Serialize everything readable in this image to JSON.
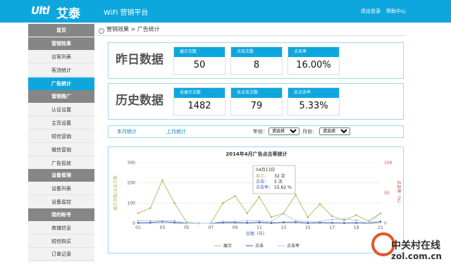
{
  "header": {
    "logo_mark": "Ultl",
    "logo_text": "艾泰",
    "app_title": "WiFi 营销平台",
    "logout": "退出登录",
    "help": "帮助中心"
  },
  "sidebar": {
    "items": [
      {
        "label": "首页",
        "kind": "head"
      },
      {
        "label": "营销效果",
        "kind": "head"
      },
      {
        "label": "访客列表",
        "kind": "plain"
      },
      {
        "label": "客流统计",
        "kind": "plain"
      },
      {
        "label": "广告统计",
        "kind": "active"
      },
      {
        "label": "营销推广",
        "kind": "head"
      },
      {
        "label": "认证设置",
        "kind": "plain"
      },
      {
        "label": "主页设置",
        "kind": "plain"
      },
      {
        "label": "短信营销",
        "kind": "plain"
      },
      {
        "label": "微信营销",
        "kind": "plain"
      },
      {
        "label": "广告投放",
        "kind": "plain"
      },
      {
        "label": "设备管理",
        "kind": "head"
      },
      {
        "label": "设备列表",
        "kind": "plain"
      },
      {
        "label": "设备监控",
        "kind": "plain"
      },
      {
        "label": "我的帐号",
        "kind": "head"
      },
      {
        "label": "商铺信息",
        "kind": "plain"
      },
      {
        "label": "短信购买",
        "kind": "plain"
      },
      {
        "label": "订单记录",
        "kind": "plain"
      }
    ]
  },
  "breadcrumb": "营销效果 > 广告统计",
  "yesterday": {
    "label": "昨日数据",
    "stats": [
      {
        "title": "展示次数",
        "value": "50"
      },
      {
        "title": "点击次数",
        "value": "8"
      },
      {
        "title": "点击率",
        "value": "16.00%"
      }
    ]
  },
  "history": {
    "label": "历史数据",
    "stats": [
      {
        "title": "总展示次数",
        "value": "1482"
      },
      {
        "title": "总点击次数",
        "value": "79"
      },
      {
        "title": "总点击率",
        "value": "5.33%"
      }
    ]
  },
  "filter": {
    "this_month": "本月统计",
    "last_month": "上月统计",
    "year_label": "年份：",
    "year_value": "请选择",
    "month_label": "月份：",
    "month_value": "请选择"
  },
  "colors": {
    "accent": "#0da7de",
    "show_series": "#b5b35c",
    "click_series": "#3a5fb0",
    "rate_series": "#a8c6e8",
    "right_axis": "#c0504d"
  },
  "chart_data": {
    "type": "line",
    "title": "2014年4月广告点击率统计",
    "xlabel": "日期（号）",
    "ylabel_left": "展示次数/点击次数",
    "ylabel_right": "点击率（%）",
    "x": [
      "01",
      "02",
      "03",
      "04",
      "05",
      "06",
      "07",
      "08",
      "09",
      "10",
      "11",
      "12",
      "13",
      "14",
      "15",
      "16",
      "17",
      "18",
      "19",
      "20",
      "21"
    ],
    "xticks": [
      "01",
      "03",
      "05",
      "07",
      "09",
      "11",
      "13",
      "15",
      "17",
      "19",
      "21"
    ],
    "ylim_left": [
      0,
      300
    ],
    "yticks_left": [
      0,
      100,
      200,
      300
    ],
    "ylim_right": [
      0,
      100
    ],
    "yticks_right": [
      0,
      50,
      100
    ],
    "series": [
      {
        "name": "展示",
        "axis": "left",
        "values": [
          50,
          75,
          212,
          100,
          5,
          0,
          0,
          100,
          135,
          50,
          130,
          30,
          50,
          140,
          30,
          95,
          35,
          15,
          40,
          10,
          50
        ]
      },
      {
        "name": "点击",
        "axis": "left",
        "values": [
          2,
          3,
          8,
          4,
          0,
          0,
          0,
          3,
          4,
          2,
          5,
          1,
          5,
          6,
          1,
          3,
          2,
          1,
          2,
          0,
          8
        ]
      },
      {
        "name": "点击率",
        "axis": "right",
        "values": [
          4,
          4,
          4,
          4,
          0,
          0,
          0,
          3,
          3,
          4,
          4,
          3,
          15.62,
          4,
          3,
          3,
          6,
          7,
          5,
          0,
          16
        ]
      }
    ],
    "tooltip": {
      "date": "04月13日",
      "lines": [
        {
          "label": "展示：",
          "value": "32 次"
        },
        {
          "label": "点击：",
          "value": "5 次"
        },
        {
          "label": "点击率：",
          "value": "15.62 %"
        }
      ]
    },
    "legend_position": "bottom-center"
  },
  "watermark": {
    "cn": "中关村在线",
    "en": "zol.com.cn"
  }
}
